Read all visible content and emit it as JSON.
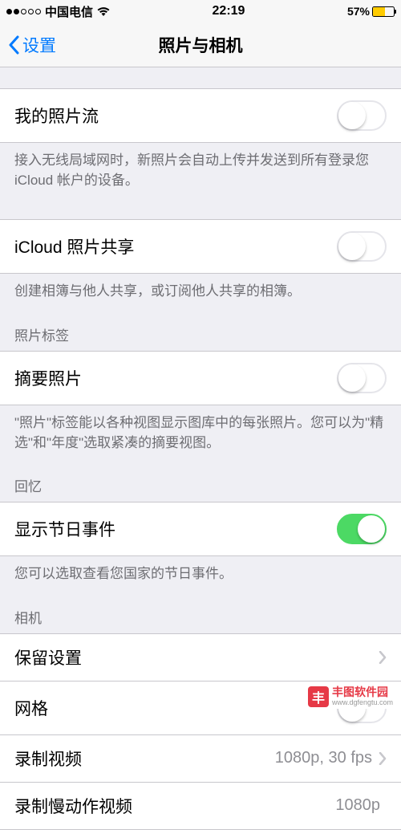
{
  "statusBar": {
    "carrier": "中国电信",
    "time": "22:19",
    "battery": "57%"
  },
  "nav": {
    "back": "设置",
    "title": "照片与相机"
  },
  "rows": {
    "myPhotoStream": "我的照片流",
    "icloudSharing": "iCloud 照片共享",
    "summaryPhotos": "摘要照片",
    "showHoliday": "显示节日事件",
    "preserve": "保留设置",
    "grid": "网格",
    "recordVideo": "录制视频",
    "recordVideoDetail": "1080p, 30 fps",
    "recordSlomo": "录制慢动作视频",
    "recordSlomoDetail": "1080p"
  },
  "footers": {
    "photoStream": "接入无线局域网时，新照片会自动上传并发送到所有登录您 iCloud 帐户的设备。",
    "sharing": "创建相簿与他人共享，或订阅他人共享的相簿。",
    "summary": "\"照片\"标签能以各种视图显示图库中的每张照片。您可以为\"精选\"和\"年度\"选取紧凑的摘要视图。",
    "holiday": "您可以选取查看您国家的节日事件。"
  },
  "headers": {
    "photoTag": "照片标签",
    "memories": "回忆",
    "camera": "相机"
  },
  "watermark": {
    "name": "丰图软件园",
    "url": "www.dgfengtu.com"
  }
}
